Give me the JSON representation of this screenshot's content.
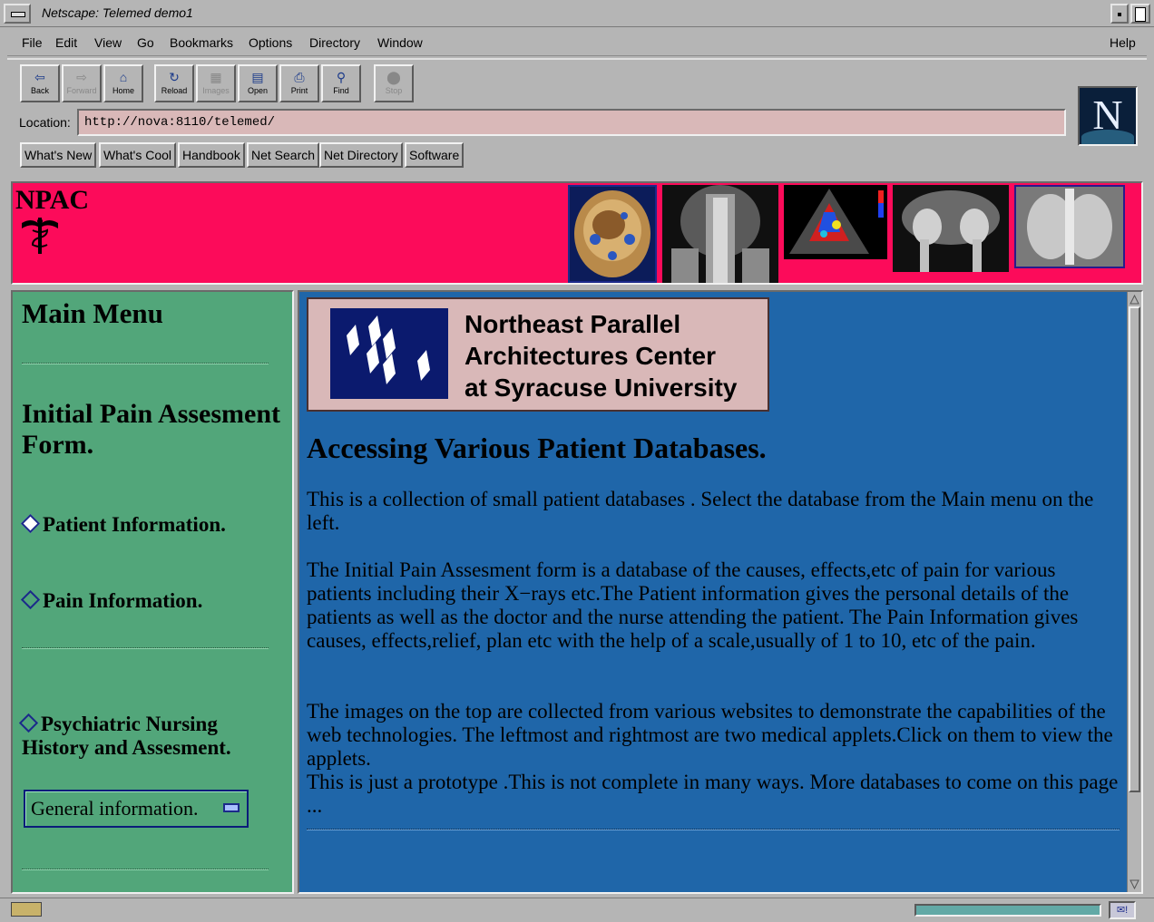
{
  "window": {
    "title": "Netscape: Telemed demo1"
  },
  "menubar": {
    "items": [
      "File",
      "Edit",
      "View",
      "Go",
      "Bookmarks",
      "Options",
      "Directory",
      "Window"
    ],
    "help": "Help"
  },
  "toolbar": {
    "buttons": [
      {
        "label": "Back",
        "icon": "back-arrow-icon",
        "enabled": true
      },
      {
        "label": "Forward",
        "icon": "forward-arrow-icon",
        "enabled": false
      },
      {
        "label": "Home",
        "icon": "home-icon",
        "enabled": true
      },
      {
        "label": "Reload",
        "icon": "reload-icon",
        "enabled": true
      },
      {
        "label": "Images",
        "icon": "images-icon",
        "enabled": false
      },
      {
        "label": "Open",
        "icon": "open-icon",
        "enabled": true
      },
      {
        "label": "Print",
        "icon": "print-icon",
        "enabled": true
      },
      {
        "label": "Find",
        "icon": "find-icon",
        "enabled": true
      },
      {
        "label": "Stop",
        "icon": "stop-icon",
        "enabled": false
      }
    ]
  },
  "location": {
    "label": "Location:",
    "url": "http://nova:8110/telemed/"
  },
  "directory_buttons": [
    "What's New",
    "What's Cool",
    "Handbook",
    "Net Search",
    "Net Directory",
    "Software"
  ],
  "brand_logo": "N",
  "banner": {
    "title": "NPAC",
    "background": "#fc0b5a",
    "images": [
      "head-cross-section-image",
      "neck-mri-image",
      "echocardiogram-image",
      "pelvis-mri-image",
      "chest-xray-image"
    ]
  },
  "left_menu": {
    "title": "Main Menu",
    "section_title": "Initial Pain Assesment Form.",
    "links": [
      "Patient Information.",
      "Pain Information.",
      "Psychiatric Nursing History and Assesment."
    ],
    "select_value": "General information."
  },
  "content": {
    "org_name_lines": [
      "Northeast Parallel",
      "Architectures Center",
      "at Syracuse University"
    ],
    "heading": "Accessing Various Patient Databases.",
    "paragraphs": [
      "This is a collection of small patient databases . Select the database from the Main menu on the left.",
      "The Initial Pain Assesment form is a database of the causes, effects,etc of pain for various patients including their X−rays etc.The Patient information gives the personal details of the patients as well as the doctor and the nurse attending the patient. The Pain Information gives causes, effects,relief, plan etc with the help of a scale,usually of 1 to 10, etc of the pain.",
      "The images on the top are collected from various websites to demonstrate the capabilities of the web technologies. The leftmost and rightmost are two medical applets.Click on them to view the applets.",
      "This is just a prototype .This is not complete in many ways. More databases to come on this page ..."
    ]
  },
  "colors": {
    "chrome": "#b5b5b5",
    "left_frame": "#52a67a",
    "right_frame": "#1f66a9",
    "location_field": "#d9b8b8"
  }
}
